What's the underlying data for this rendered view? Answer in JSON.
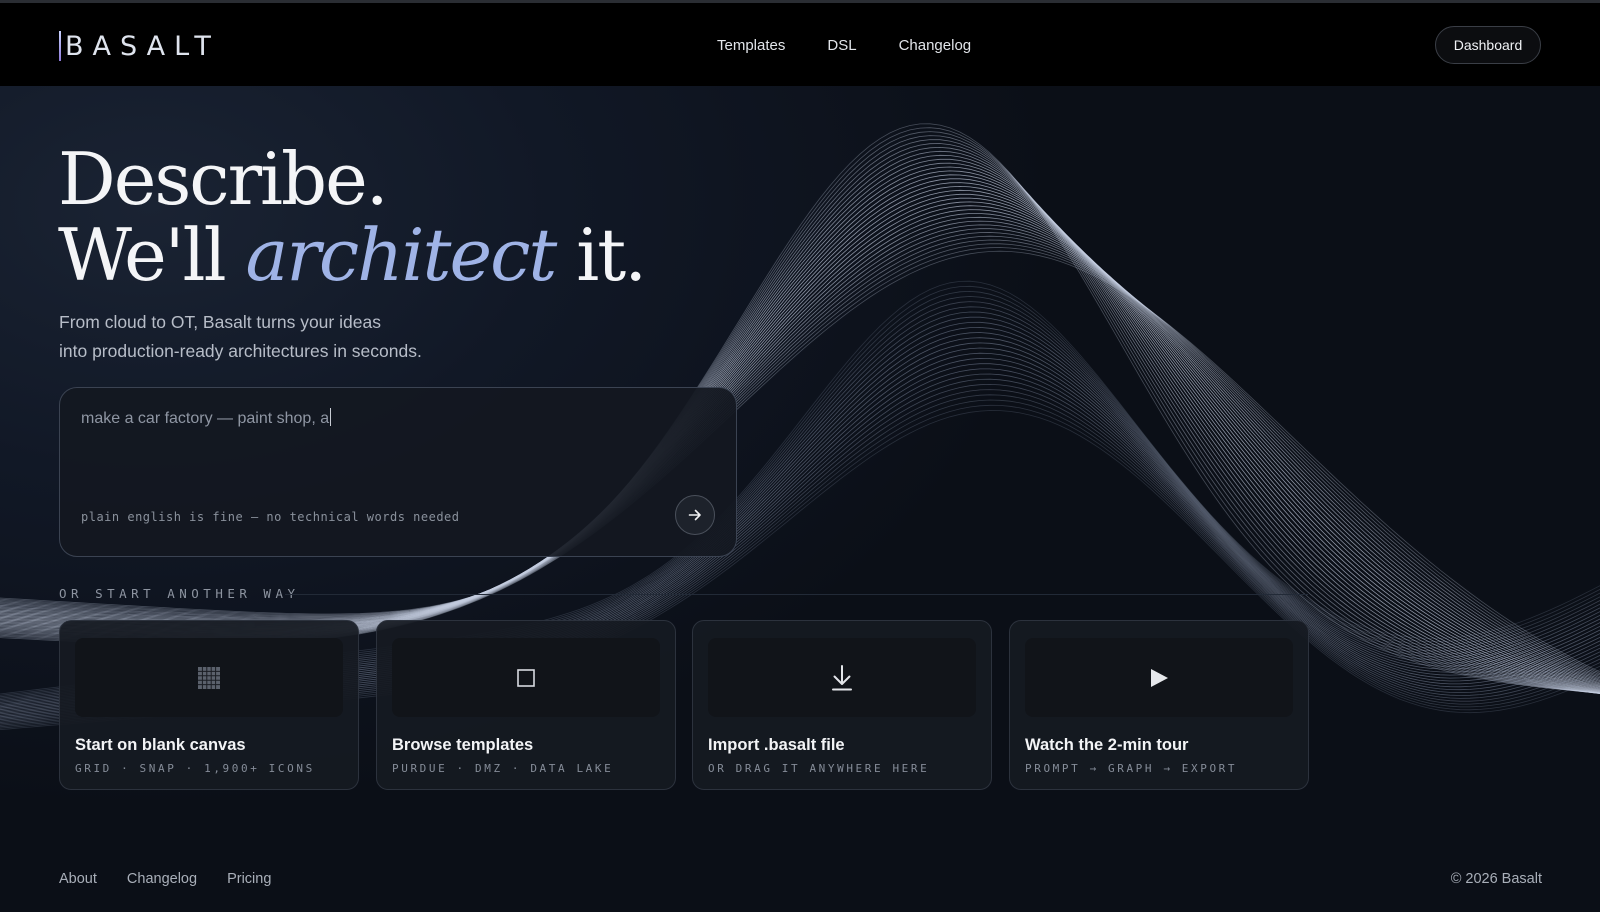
{
  "nav": {
    "logo_text": "BASALT",
    "links": [
      "Templates",
      "DSL",
      "Changelog"
    ],
    "dashboard_label": "Dashboard"
  },
  "hero": {
    "headline_line1": "Describe.",
    "headline_line2_pre": "We'll ",
    "headline_line2_em": "architect",
    "headline_line2_post": " it.",
    "subtitle_line1": "From cloud to OT, Basalt turns your ideas",
    "subtitle_line2": "into production-ready architectures in seconds."
  },
  "prompt": {
    "value": "make a car factory — paint shop, a",
    "hint": "plain english is fine — no technical words needed",
    "submit_icon": "arrow-right-icon"
  },
  "start": {
    "label": "OR START ANOTHER WAY",
    "cards": [
      {
        "title": "Start on blank canvas",
        "meta": "GRID · SNAP · 1,900+ ICONS",
        "icon": "grid-icon"
      },
      {
        "title": "Browse templates",
        "meta": "PURDUE · DMZ · DATA LAKE",
        "icon": "square-icon"
      },
      {
        "title": "Import .basalt file",
        "meta": "OR DRAG IT ANYWHERE HERE",
        "icon": "download-icon"
      },
      {
        "title": "Watch the 2-min tour",
        "meta": "PROMPT → GRAPH → EXPORT",
        "icon": "play-icon"
      }
    ]
  },
  "footer": {
    "links": [
      "About",
      "Changelog",
      "Pricing"
    ],
    "copyright": "© 2026 Basalt"
  },
  "colors": {
    "accent": "#9fb3e6",
    "background": "#0b0f17",
    "navbar": "#000000"
  }
}
